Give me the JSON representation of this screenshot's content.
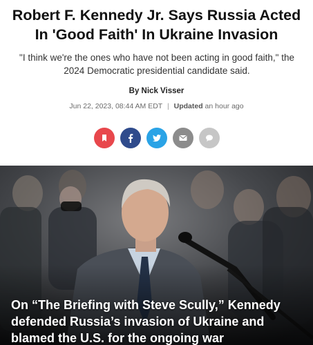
{
  "article": {
    "headline": "Robert F. Kennedy Jr. Says Russia Acted In 'Good Faith' In Ukraine Invasion",
    "subheadline": "\"I think we're the ones who have not been acting in good faith,\" the 2024 Democratic presidential candidate said.",
    "byline_prefix": "By",
    "author": "Nick Visser",
    "published": "Jun 22, 2023, 08:44 AM EDT",
    "separator": "|",
    "updated_label": "Updated",
    "updated_value": "an hour ago"
  },
  "share": {
    "buttons": [
      {
        "name": "bookmark",
        "color": "#e8474c"
      },
      {
        "name": "facebook",
        "color": "#2f4b8c"
      },
      {
        "name": "twitter",
        "color": "#2aa3e6"
      },
      {
        "name": "email",
        "color": "#8c8c8c"
      },
      {
        "name": "comments",
        "color": "#c6c6c6"
      }
    ]
  },
  "hero": {
    "caption": "On “The Briefing with Steve Scully,” Kennedy defended Russia’s invasion of Ukraine and blamed the U.S. for the ongoing war"
  }
}
